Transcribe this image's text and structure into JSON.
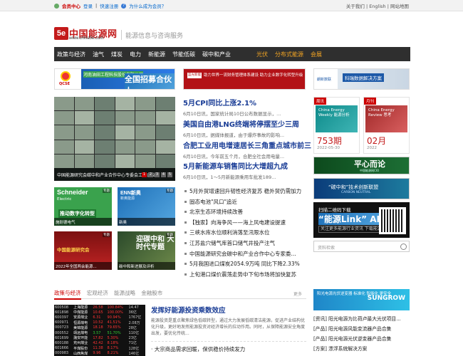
{
  "topbar": {
    "member": "会员中心",
    "login": "登录",
    "quick_reg": "快速注册",
    "how_member": "为什么成为会员？",
    "right_links": "关于我们 | English | 网站地图"
  },
  "header": {
    "logo_mark": "5e",
    "logo_cn": "中国能源网",
    "logo_url": "www.china5e.com",
    "slogan": "能源信息与咨询服务"
  },
  "nav": {
    "items": [
      "政策与经济",
      "油气",
      "煤炭",
      "电力",
      "新能源",
      "节能低碳",
      "碳中和产业"
    ],
    "highlight": [
      "光伏",
      "分布式能源",
      "会展"
    ]
  },
  "banners": {
    "b1_company": "河南油田工程科技股份有限公司",
    "b1_title": "全国招募合伙人",
    "b1_logo": "QCSE",
    "b2_logo": "蓝光新能",
    "b2_text": "助力世界一流财务管理体系建设  助力企业数字化转型升级",
    "b3_logo": "朗新数联",
    "b3_title": "科瑞数据解决方案"
  },
  "slider": {
    "caption": "中国能源研究会碳中和产业合作中心专委会工作会议",
    "dots": [
      "1",
      "2",
      "3",
      "4",
      "5"
    ]
  },
  "headlines": [
    {
      "title": "5月CPI同比上涨2.1%",
      "summary": "6月10日讯，国家统计局10日公布数据显示，..."
    },
    {
      "title": "美国自由港LNG终端将停摆至少三周",
      "summary": "6月10日讯，据媒体报道，由于爆炸事故的影响..."
    },
    {
      "title": "合肥工业用电增速居长三角重点城市前三",
      "summary": "6月10日讯，今年前五个月，合肥全社会用电量..."
    },
    {
      "title": "5月新能源车销售同比大增超九成",
      "summary": "6月10日讯，1～5月新能源乘用车批发189..."
    }
  ],
  "tiles": [
    {
      "big": "Schneider",
      "sub": "Electric",
      "yellow": "推动数字化转型",
      "tag": "专题",
      "caption": "施耐德电气"
    },
    {
      "big": "ENN新奥",
      "sub": "新奥能源",
      "tag": "专题",
      "caption": "新奥"
    },
    {
      "big": "中国能源研究会",
      "tag": "专题",
      "caption": "2022年全国两会能源..."
    },
    {
      "big": "迎碳中和 大时代专题",
      "tag": "专题",
      "caption": "碳中和新进展及评析"
    }
  ],
  "headlist": [
    "5月外贸增速回升韧性经济复苏 稳外贸仍需加力",
    "固态电池\"风口\"追近",
    "北京生态环境持续改善",
    "【独家】向海争风——海上风电建设提速",
    "三峡水库水位顺利消落至汛限水位",
    "江苏盐穴储气库首口储气井投产注气",
    "中国能源研究会碳中和产业合作中心专家委...",
    "5月我国进口煤炭2054.9万吨 同比下降2.33%",
    "上旬港口煤价震荡走势中下旬市场将加快复苏"
  ],
  "rpanels": [
    {
      "tag": "周讯",
      "img": "China Energy Weekly 能源分析",
      "big": "753期",
      "date": "2022-05-30"
    },
    {
      "tag": "月刊",
      "img": "China Energy Review 思考",
      "big": "02月",
      "date": "2022"
    }
  ],
  "rb1": {
    "title": "平心而论",
    "sub": "中国能源网CIO"
  },
  "rb2": {
    "title": "“碳中和”技术创新联盟",
    "sub": "CARBON NEUTRAL"
  },
  "rb3": {
    "line1": "扫描二维码下载",
    "line2": "“能源Link” APP",
    "sub": "关注更多能源行业资讯  下载能源行业应用"
  },
  "search": {
    "placeholder": "资料检索"
  },
  "section": {
    "tabs": [
      "政策与经济",
      "宏观经济",
      "能源战略",
      "金融股市"
    ],
    "more": "更多"
  },
  "stocks": [
    [
      "600508",
      "上海能源",
      "26.58",
      "100.84%",
      "14.47",
      "up"
    ],
    [
      "601898",
      "中煤能源",
      "10.65",
      "100.00%",
      "36亿",
      "up"
    ],
    [
      "600397",
      "安源煤业",
      "6.31",
      "90.94%",
      "1767亿",
      "up"
    ],
    [
      "600971",
      "恒源煤电",
      "10.52",
      "41.51%",
      "2.08万",
      "up"
    ],
    [
      "000723",
      "美锦能源",
      "18.18",
      "79.65%",
      "28亿",
      "up"
    ],
    [
      "000552",
      "靖远煤电",
      "3.57",
      "51.70%",
      "110亿",
      "dn"
    ],
    [
      "601699",
      "潞安环能",
      "17.82",
      "5.30%",
      "23亿",
      "up"
    ],
    [
      "600188",
      "兖州煤业",
      "42.42",
      "8.18%",
      "71亿",
      "up"
    ],
    [
      "601666",
      "平煤股份",
      "11.38",
      "8.17%",
      "128亿",
      "up"
    ],
    [
      "000983",
      "山西焦煤",
      "9.96",
      "8.21%",
      "146亿",
      "up"
    ]
  ],
  "news": {
    "title": "发挥好能源投资乘数效应",
    "body": "能源投资是重点聚焦绿色低碳转型，通过大力发展低碳清洁能源，促进产业结构优化升级，更好地发挥能源投资对经济增长的拉动作用。同时，从保障能源安全角度出发，要优化传统...",
    "next": "· 大宗商品需求回暖，保供稳价持续发力"
  },
  "ad": {
    "text": "阳光电源光伏逆变器 标准化 智能化 更安全",
    "brand": "SUNGROW"
  },
  "rlist": [
    "[资讯] 阳光电源为比荷卢最大光伏项目...",
    "[产品] 阳光电源风能变流器产品合集",
    "[产品] 阳光电源光伏逆变器产品合集",
    "[方案] 漂浮系统解决方案"
  ]
}
